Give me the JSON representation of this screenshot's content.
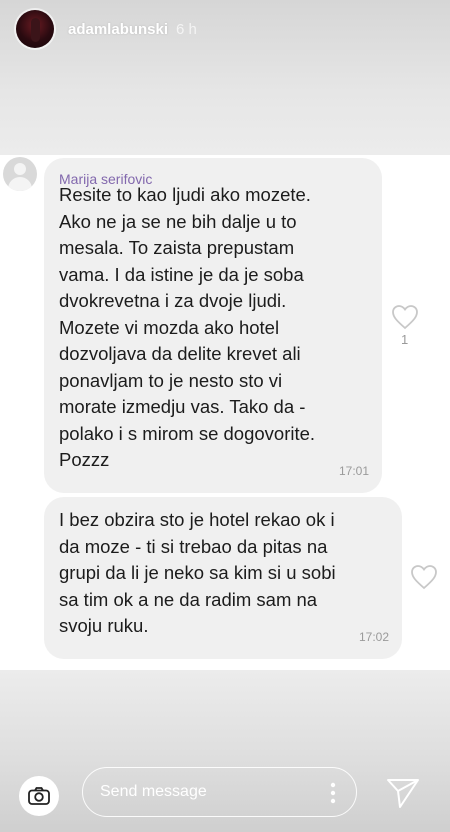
{
  "story": {
    "username": "adamlabunski",
    "time": "6 h"
  },
  "messages": [
    {
      "sender": "Marija serifovic",
      "text": "Resite to kao ljudi ako mozete.\nAko ne ja se ne bih dalje u to\nmesala. To zaista prepustam\nvama. I da istine je da je soba\ndvokrevetna i za dvoje ljudi.\nMozete vi mozda ako hotel\ndozvoljava da delite krevet ali\nponavljam to je nesto sto vi\nmorate izmedju vas. Tako da -\npolako i s mirom se dogovorite.\nPozzz",
      "time": "17:01",
      "likes": "1"
    },
    {
      "text": "I bez obzira sto je hotel rekao ok i\nda moze - ti si trebao da pitas na\ngrupi da li je neko sa kim si u sobi\nsa tim ok a ne da radim sam na\nsvoju ruku.",
      "time": "17:02"
    }
  ],
  "reply": {
    "placeholder": "Send message"
  },
  "colors": {
    "sender_name": "#8268ad",
    "bubble": "#f0f0f0",
    "story_overlay": "#dcdcdc"
  },
  "icons": {
    "camera": "camera-icon",
    "like": "heart-icon",
    "more": "more-dots-icon",
    "send": "send-icon"
  }
}
